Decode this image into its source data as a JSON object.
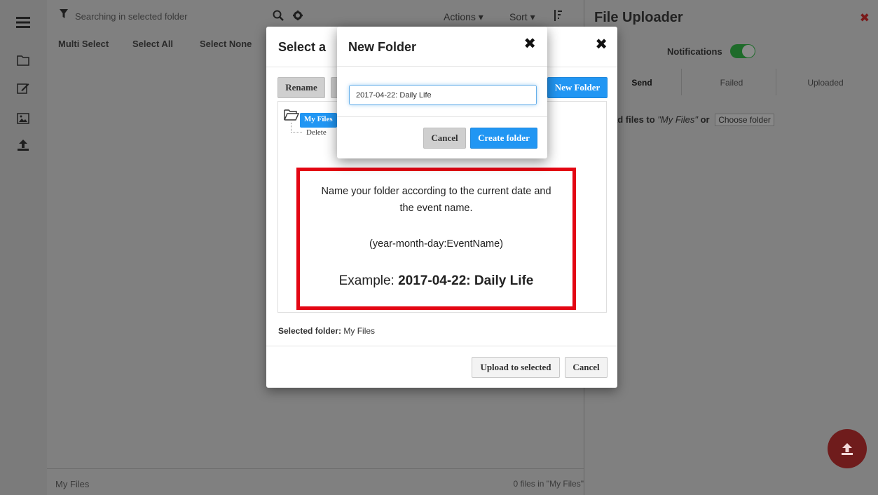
{
  "rail": {
    "icons": [
      "menu-icon",
      "folder-icon",
      "edit-icon",
      "image-icon",
      "upload-icon"
    ]
  },
  "browser": {
    "search_placeholder": "Searching in selected folder",
    "actions_label": "Actions ▾",
    "sort_label": "Sort ▾",
    "multi_select": "Multi Select",
    "select_all": "Select All",
    "select_none": "Select None",
    "footer_path": "My Files",
    "footer_count": "0 files in \"My Files\""
  },
  "uploader": {
    "title": "File Uploader",
    "close": "✖",
    "notifications_label": "Notifications",
    "notifications_on": true,
    "tabs": [
      {
        "label": "Send",
        "selected": true
      },
      {
        "label": "Failed",
        "selected": false
      },
      {
        "label": "Uploaded",
        "selected": false
      }
    ],
    "msg_prefix": "ad files to",
    "msg_target": "\"My Files\"",
    "msg_or": "or",
    "choose_folder": "Choose folder"
  },
  "select_dialog": {
    "title": "Select a",
    "close": "✖",
    "rename_button": "Rename",
    "new_folder_button": "New Folder",
    "tree_root": "My Files",
    "tree_child": "Delete",
    "selected_label": "Selected folder:",
    "selected_value": "My Files",
    "upload_button": "Upload to selected",
    "cancel_button": "Cancel"
  },
  "note": {
    "line1": "Name your folder according to the current date and the event name.",
    "line2": "(year-month-day:EventName)",
    "example_prefix": "Example: ",
    "example_value": "2017-04-22: Daily Life",
    "border_color": "#e30613"
  },
  "new_folder": {
    "title": "New Folder",
    "close": "✖",
    "input_value": "2017-04-22: Daily Life",
    "cancel_button": "Cancel",
    "create_button": "Create folder"
  },
  "colors": {
    "accent": "#2196f3",
    "overlay": "#808080",
    "fab": "#6f1c1c",
    "toggle": "#1e6b2a"
  }
}
